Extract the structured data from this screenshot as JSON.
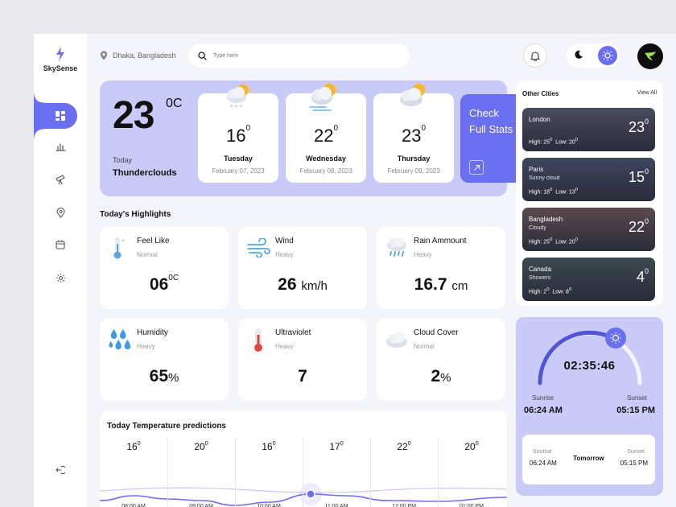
{
  "brand": {
    "name": "SkySense"
  },
  "topbar": {
    "location": "Dhaka, Bangladesh",
    "search_placeholder": "Type here"
  },
  "colors": {
    "accent": "#6a6ef0",
    "hero_bg": "#c9caf7"
  },
  "hero": {
    "temp": "23",
    "unit": "0C",
    "label": "Today",
    "condition": "Thunderclouds",
    "forecast": [
      {
        "temp": "16",
        "deg": "0",
        "day": "Tuesday",
        "date": "February 07, 2023",
        "icon": "snow-cloud-sun-icon"
      },
      {
        "temp": "22",
        "deg": "0",
        "day": "Wednesday",
        "date": "February 08, 2023",
        "icon": "wind-cloud-sun-icon"
      },
      {
        "temp": "23",
        "deg": "0",
        "day": "Thursday",
        "date": "February 09, 2023",
        "icon": "cloud-sun-icon"
      }
    ],
    "stats": {
      "line1": "Check",
      "line2": "Full Stats"
    }
  },
  "highlights": {
    "title": "Today's Highlights",
    "items": [
      {
        "name": "Feel Like",
        "sub": "Normal",
        "value": "06",
        "sup": "0C",
        "unit": "",
        "icon": "thermometer-snow-icon"
      },
      {
        "name": "Wind",
        "sub": "Heavy",
        "value": "26",
        "sup": "",
        "unit": "km/h",
        "icon": "wind-icon"
      },
      {
        "name": "Rain Ammount",
        "sub": "Heavy",
        "value": "16.7",
        "sup": "",
        "unit": "cm",
        "icon": "rain-cloud-icon"
      },
      {
        "name": "Humidity",
        "sub": "Heavy",
        "value": "65",
        "sup": "",
        "unit": "%",
        "icon": "droplets-icon"
      },
      {
        "name": "Ultraviolet",
        "sub": "Heavy",
        "value": "7",
        "sup": "",
        "unit": "",
        "icon": "thermometer-hot-icon"
      },
      {
        "name": "Cloud Cover",
        "sub": "Normal",
        "value": "2",
        "sup": "",
        "unit": "%",
        "icon": "cloud-icon"
      }
    ]
  },
  "predictions": {
    "title": "Today Temperature predictions",
    "items": [
      {
        "temp": "16",
        "deg": "0",
        "time": "08:00 AM"
      },
      {
        "temp": "20",
        "deg": "0",
        "time": "09:00 AM"
      },
      {
        "temp": "16",
        "deg": "0",
        "time": "10:00 AM"
      },
      {
        "temp": "17",
        "deg": "0",
        "time": "11:00 AM"
      },
      {
        "temp": "22",
        "deg": "0",
        "time": "12:00 PM"
      },
      {
        "temp": "20",
        "deg": "0",
        "time": "01:00 PM"
      }
    ],
    "selected_index": 3
  },
  "cities": {
    "title": "Other Cities",
    "view_all": "View All",
    "items": [
      {
        "name": "London",
        "cond": "",
        "high": "High: 25",
        "low": "Low: 20",
        "temp": "23",
        "deg": "0",
        "bg": "#4b4a5e"
      },
      {
        "name": "Paris",
        "cond": "Sunny cloud",
        "high": "High: 18",
        "low": "Low: 13",
        "temp": "15",
        "deg": "0",
        "bg": "#3f4660"
      },
      {
        "name": "Bangladesh",
        "cond": "Cloudy",
        "high": "High: 25",
        "low": "Low: 20",
        "temp": "22",
        "deg": "0",
        "bg": "#5a4a4e"
      },
      {
        "name": "Canada",
        "cond": "Showers",
        "high": "High: 2",
        "low": "Low: 8",
        "temp": "4",
        "deg": "0",
        "bg": "#3c4a50"
      }
    ]
  },
  "sun": {
    "time": "02:35:46",
    "sunrise_label": "Sunrise",
    "sunrise": "06:24 AM",
    "sunset_label": "Sunset",
    "sunset": "05:15 PM",
    "tomorrow": {
      "label": "Tomorrow",
      "sunrise_label": "Sunrise",
      "sunrise": "06:24 AM",
      "sunset_label": "Sunset",
      "sunset": "05:15 PM"
    }
  }
}
